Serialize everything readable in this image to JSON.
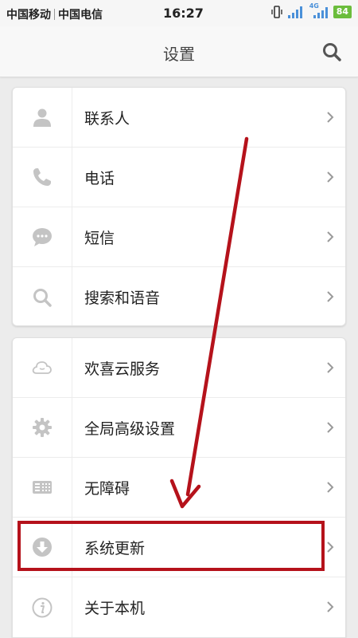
{
  "status_bar": {
    "carrier_1": "中国移动",
    "carrier_2": "中国电信",
    "time": "16:27",
    "network_type": "4G",
    "battery": "84"
  },
  "header": {
    "title": "设置",
    "search_icon": "search-icon"
  },
  "groups": [
    {
      "items": [
        {
          "label": "联系人",
          "icon": "person-icon"
        },
        {
          "label": "电话",
          "icon": "phone-icon"
        },
        {
          "label": "短信",
          "icon": "message-bubble-icon"
        },
        {
          "label": "搜索和语音",
          "icon": "search-icon"
        }
      ]
    },
    {
      "items": [
        {
          "label": "欢喜云服务",
          "icon": "cloud-icon"
        },
        {
          "label": "全局高级设置",
          "icon": "gear-icon"
        },
        {
          "label": "无障碍",
          "icon": "accessibility-keyboard-icon"
        },
        {
          "label": "系统更新",
          "icon": "download-arrow-icon"
        },
        {
          "label": "关于本机",
          "icon": "info-icon"
        }
      ]
    }
  ],
  "annotation": {
    "highlight_color": "#b5121b",
    "highlighted_item": "系统更新"
  },
  "colors": {
    "battery": "#6bbd3c",
    "icon_gray": "#c4c4c4",
    "annotation_red": "#b5121b"
  }
}
